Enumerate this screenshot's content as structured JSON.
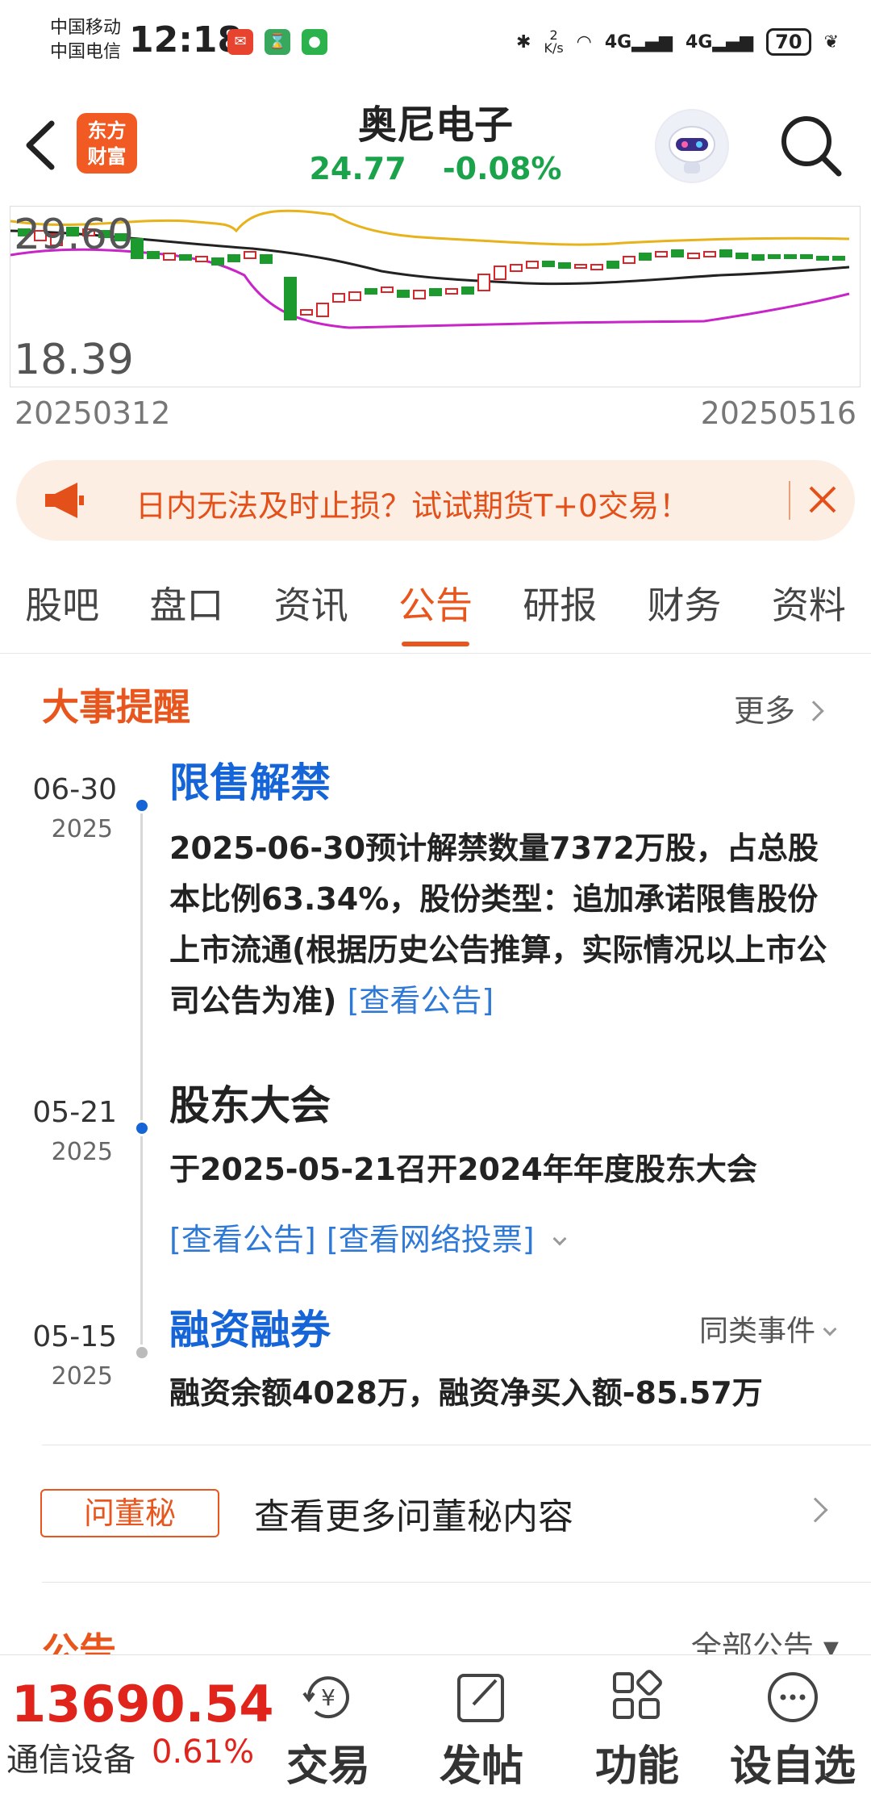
{
  "status_bar": {
    "carrier1": "中国移动",
    "carrier2": "中国电信",
    "time": "12:18",
    "net_speed_value": "2",
    "net_speed_unit": "K/s",
    "signal1": "4G",
    "signal2": "4G",
    "battery": "70"
  },
  "header": {
    "logo_line1": "东方",
    "logo_line2": "财富",
    "stock_name": "奥尼电子",
    "price": "24.77",
    "change_pct": "-0.08%"
  },
  "chart": {
    "y_high": "29.60",
    "y_low": "18.39",
    "start_date": "20250312",
    "end_date": "20250516"
  },
  "chart_data": {
    "type": "line",
    "x_range": [
      "20250312",
      "20250516"
    ],
    "ylim": [
      18.39,
      29.6
    ],
    "series": []
  },
  "banner": {
    "text": "日内无法及时止损？试试期货T+0交易！"
  },
  "tabs": [
    "股吧",
    "盘口",
    "资讯",
    "公告",
    "研报",
    "财务",
    "资料"
  ],
  "active_tab": "公告",
  "events_section": {
    "title": "大事提醒",
    "more": "更多"
  },
  "events": [
    {
      "date": "06-30",
      "year": "2025",
      "title": "限售解禁",
      "body": "2025-06-30预计解禁数量7372万股，占总股本比例63.34%，股份类型：追加承诺限售股份上市流通(根据历史公告推算，实际情况以上市公司公告为准)",
      "link": "[查看公告]"
    },
    {
      "date": "05-21",
      "year": "2025",
      "title": "股东大会",
      "body": "于2025-05-21召开2024年年度股东大会",
      "link1": "[查看公告]",
      "link2": "[查看网络投票]"
    },
    {
      "date": "05-15",
      "year": "2025",
      "title": "融资融券",
      "body": "融资余额4028万，融资净买入额-85.57万",
      "similar": "同类事件"
    }
  ],
  "dongmi": {
    "tag": "问董秘",
    "text": "查看更多问董秘内容"
  },
  "announcements": {
    "title": "公告",
    "all": "全部公告"
  },
  "bottom_bar": {
    "index_value": "13690.54",
    "index_name": "通信设备",
    "index_change": "0.61%",
    "nav": [
      "交易",
      "发帖",
      "功能",
      "设自选"
    ]
  }
}
